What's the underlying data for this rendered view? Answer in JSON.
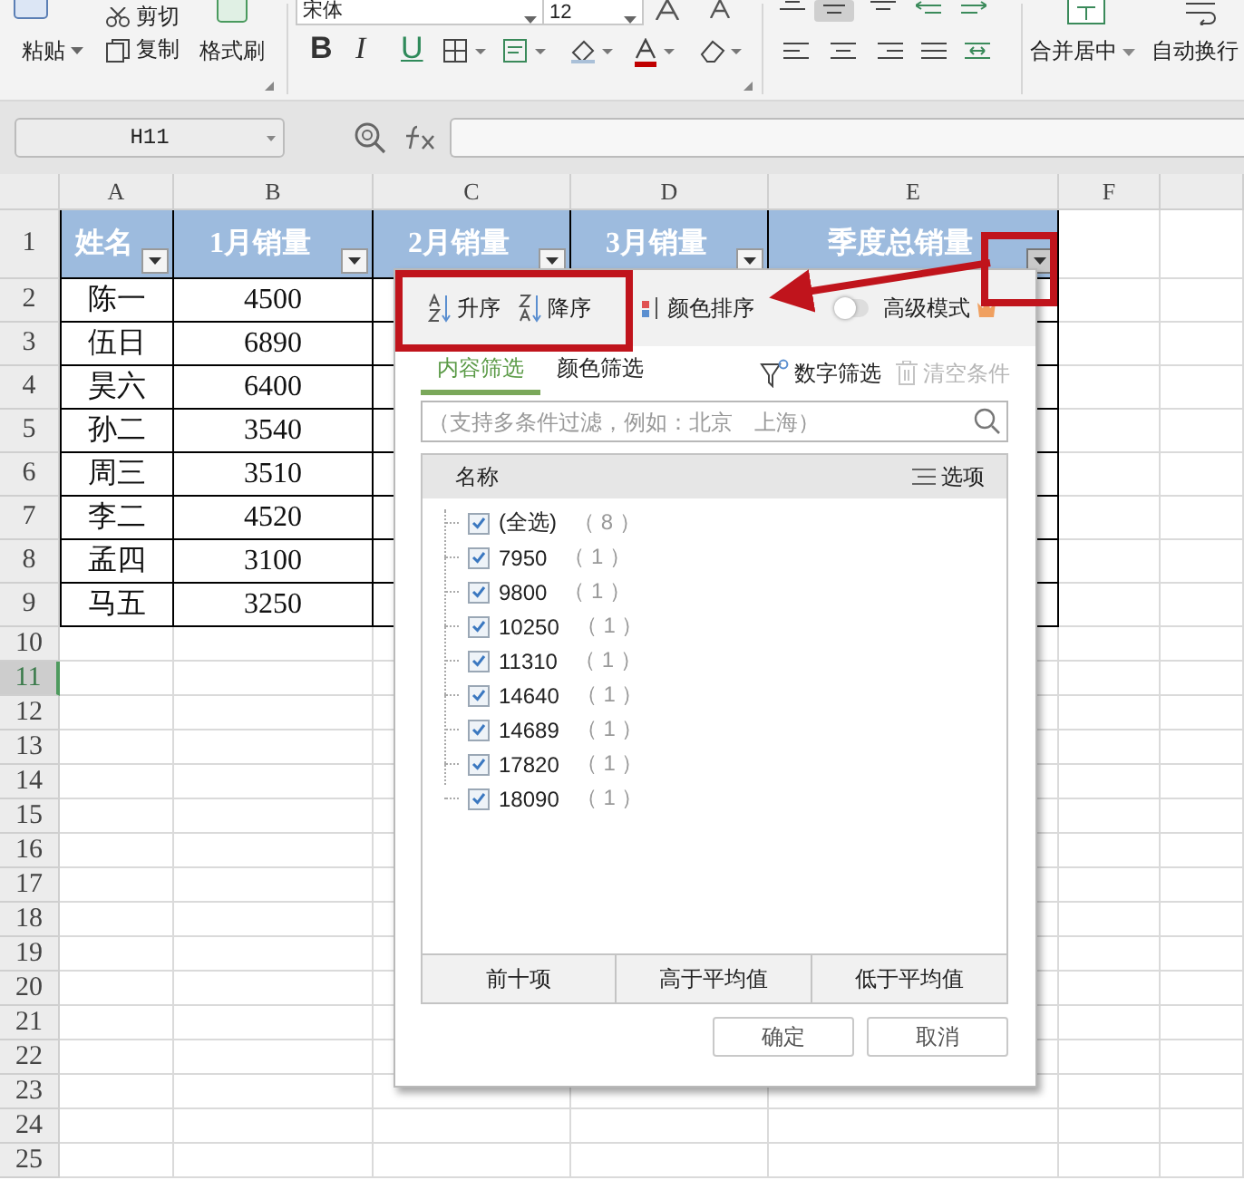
{
  "ribbon": {
    "paste": "粘贴",
    "cut": "剪切",
    "copy": "复制",
    "format_painter": "格式刷",
    "font_name": "宋体",
    "font_size": "12",
    "format_buttons": [
      {
        "kind": "bold",
        "label": "B"
      },
      {
        "kind": "italic",
        "label": "I"
      },
      {
        "kind": "underline",
        "label": "U"
      }
    ],
    "merge": "合并居中",
    "wrap": "自动换行"
  },
  "formula_bar": {
    "name_box": "H11"
  },
  "sheet": {
    "columns": [
      "A",
      "B",
      "C",
      "D",
      "E",
      "F"
    ],
    "rows": [
      {
        "label": "1",
        "selected": false
      },
      {
        "label": "2",
        "selected": false
      },
      {
        "label": "3",
        "selected": false
      },
      {
        "label": "4",
        "selected": false
      },
      {
        "label": "5",
        "selected": false
      },
      {
        "label": "6",
        "selected": false
      },
      {
        "label": "7",
        "selected": false
      },
      {
        "label": "8",
        "selected": false
      },
      {
        "label": "9",
        "selected": false
      },
      {
        "label": "10",
        "selected": false
      },
      {
        "label": "11",
        "selected": true
      },
      {
        "label": "12",
        "selected": false
      },
      {
        "label": "13",
        "selected": false
      },
      {
        "label": "14",
        "selected": false
      },
      {
        "label": "15",
        "selected": false
      },
      {
        "label": "16",
        "selected": false
      },
      {
        "label": "17",
        "selected": false
      },
      {
        "label": "18",
        "selected": false
      },
      {
        "label": "19",
        "selected": false
      },
      {
        "label": "20",
        "selected": false
      },
      {
        "label": "21",
        "selected": false
      },
      {
        "label": "22",
        "selected": false
      },
      {
        "label": "23",
        "selected": false
      },
      {
        "label": "24",
        "selected": false
      },
      {
        "label": "25",
        "selected": false
      }
    ],
    "header": [
      {
        "text": "姓名",
        "filter_active": false
      },
      {
        "text": "1月销量",
        "filter_active": false
      },
      {
        "text": "2月销量",
        "filter_active": false
      },
      {
        "text": "3月销量",
        "filter_active": false
      },
      {
        "text": "季度总销量",
        "filter_active": true
      }
    ],
    "data": [
      [
        "陈一",
        "4500"
      ],
      [
        "伍日",
        "6890"
      ],
      [
        "昊六",
        "6400"
      ],
      [
        "孙二",
        "3540"
      ],
      [
        "周三",
        "3510"
      ],
      [
        "李二",
        "4520"
      ],
      [
        "孟四",
        "3100"
      ],
      [
        "马五",
        "3250"
      ]
    ]
  },
  "filter_popup": {
    "sort": [
      {
        "kind": "ascending",
        "label": "升序"
      },
      {
        "kind": "descending",
        "label": "降序"
      }
    ],
    "color_sort": "颜色排序",
    "advanced_mode": {
      "label": "高级模式",
      "on": false
    },
    "tabs": [
      {
        "label": "内容筛选",
        "selected": true
      },
      {
        "label": "颜色筛选",
        "selected": false
      }
    ],
    "number_filter": "数字筛选",
    "clear": {
      "label": "清空条件",
      "disabled": true
    },
    "search": {
      "placeholder": "（支持多条件过滤，例如：北京　上海）"
    },
    "list": {
      "name_header": "名称",
      "options": "选项",
      "items": [
        {
          "label": "(全选)",
          "count": "（ 8 ）",
          "checked": true
        },
        {
          "label": "7950",
          "count": "（ 1 ）",
          "checked": true
        },
        {
          "label": "9800",
          "count": "（ 1 ）",
          "checked": true
        },
        {
          "label": "10250",
          "count": "（ 1 ）",
          "checked": true
        },
        {
          "label": "11310",
          "count": "（ 1 ）",
          "checked": true
        },
        {
          "label": "14640",
          "count": "（ 1 ）",
          "checked": true
        },
        {
          "label": "14689",
          "count": "（ 1 ）",
          "checked": true
        },
        {
          "label": "17820",
          "count": "（ 1 ）",
          "checked": true
        },
        {
          "label": "18090",
          "count": "（ 1 ）",
          "checked": true
        }
      ]
    },
    "quick_filters": [
      "前十项",
      "高于平均值",
      "低于平均值"
    ],
    "buttons": [
      "确定",
      "取消"
    ]
  }
}
